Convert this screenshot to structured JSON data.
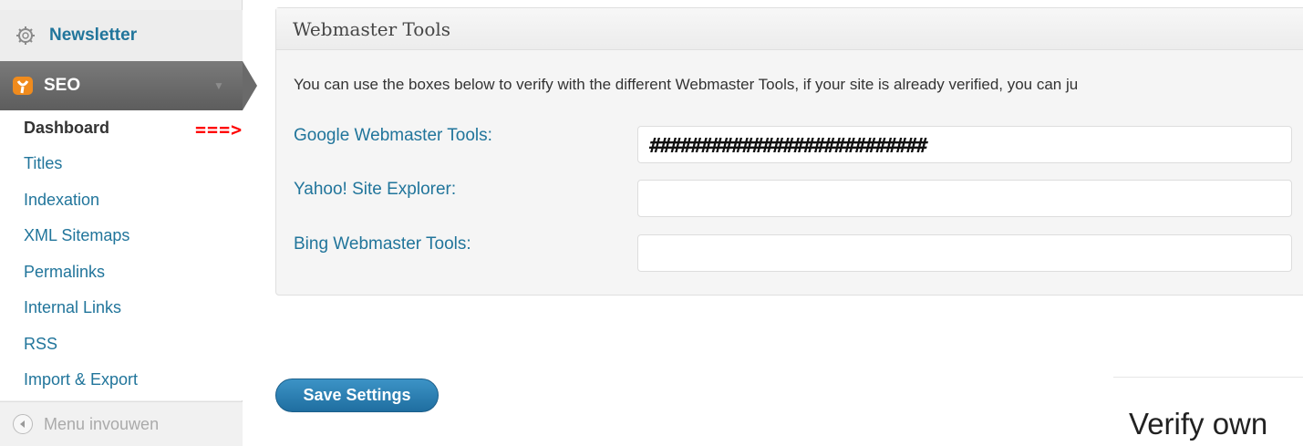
{
  "sidebar": {
    "newsletter": {
      "label": "Newsletter",
      "icon": "gear-icon"
    },
    "seo": {
      "label": "SEO",
      "icon": "yoast-seo-icon"
    },
    "submenu": [
      {
        "label": "Dashboard",
        "current": true
      },
      {
        "label": "Titles"
      },
      {
        "label": "Indexation"
      },
      {
        "label": "XML Sitemaps"
      },
      {
        "label": "Permalinks"
      },
      {
        "label": "Internal Links"
      },
      {
        "label": "RSS"
      },
      {
        "label": "Import & Export"
      }
    ],
    "collapse_label": "Menu invouwen"
  },
  "annotation": {
    "arrow": "===>"
  },
  "panel": {
    "title": "Webmaster Tools",
    "description": "You can use the boxes below to verify with the different Webmaster Tools, if your site is already verified, you can ju",
    "fields": [
      {
        "label": "Google Webmaster Tools:",
        "value": "###########################"
      },
      {
        "label": "Yahoo! Site Explorer:",
        "value": ""
      },
      {
        "label": "Bing Webmaster Tools:",
        "value": ""
      }
    ]
  },
  "save_label": "Save Settings",
  "right_heading": "Verify own",
  "colors": {
    "link": "#21759b",
    "seo_bg": "#6a6a6a",
    "arrow": "#ff0000",
    "button": "#2a7fb4"
  }
}
